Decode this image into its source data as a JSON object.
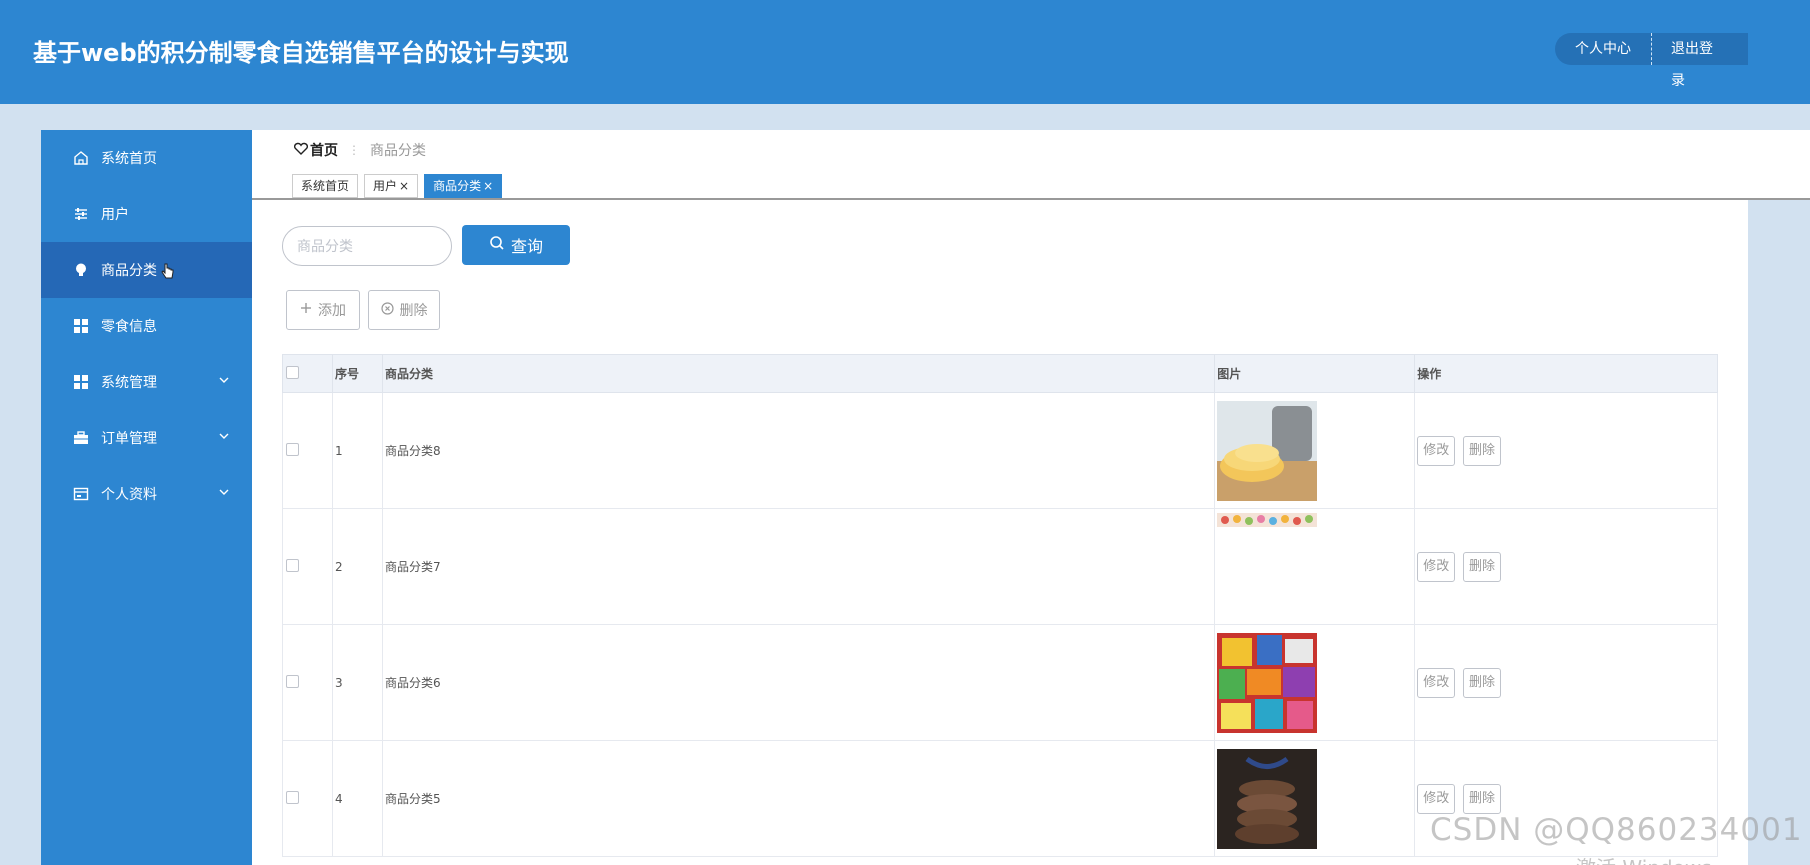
{
  "header": {
    "title": "基于web的积分制零食自选销售平台的设计与实现",
    "profile_label": "个人中心",
    "logout_label": "退出登录"
  },
  "sidebar": {
    "items": [
      {
        "label": "系统首页",
        "icon": "home-icon"
      },
      {
        "label": "用户",
        "icon": "sliders-icon"
      },
      {
        "label": "商品分类",
        "icon": "bulb-icon",
        "active": true
      },
      {
        "label": "零食信息",
        "icon": "grid-icon"
      },
      {
        "label": "系统管理",
        "icon": "grid-icon",
        "expandable": true
      },
      {
        "label": "订单管理",
        "icon": "briefcase-icon",
        "expandable": true
      },
      {
        "label": "个人资料",
        "icon": "card-icon",
        "expandable": true
      }
    ]
  },
  "breadcrumb": {
    "home": "首页",
    "current": "商品分类"
  },
  "tabs": [
    {
      "label": "系统首页",
      "closable": false
    },
    {
      "label": "用户",
      "closable": true
    },
    {
      "label": "商品分类",
      "closable": true,
      "active": true
    }
  ],
  "search": {
    "placeholder": "商品分类",
    "button_label": "查询"
  },
  "actions": {
    "add_label": "添加",
    "delete_label": "删除"
  },
  "table": {
    "columns": [
      "序号",
      "商品分类",
      "图片",
      "操作"
    ],
    "edit_label": "修改",
    "delete_label": "删除",
    "rows": [
      {
        "index": "1",
        "name": "商品分类8",
        "image": "chips-photo"
      },
      {
        "index": "2",
        "name": "商品分类7",
        "image": "candy-strip-photo"
      },
      {
        "index": "3",
        "name": "商品分类6",
        "image": "snack-pile-photo"
      },
      {
        "index": "4",
        "name": "商品分类5",
        "image": "cookies-photo"
      }
    ]
  },
  "watermark": {
    "text": "CSDN @QQ860234001",
    "sub": "激活 Windows"
  },
  "colors": {
    "primary": "#2d86d1",
    "active": "#2568b6",
    "background": "#d2e1f0"
  }
}
